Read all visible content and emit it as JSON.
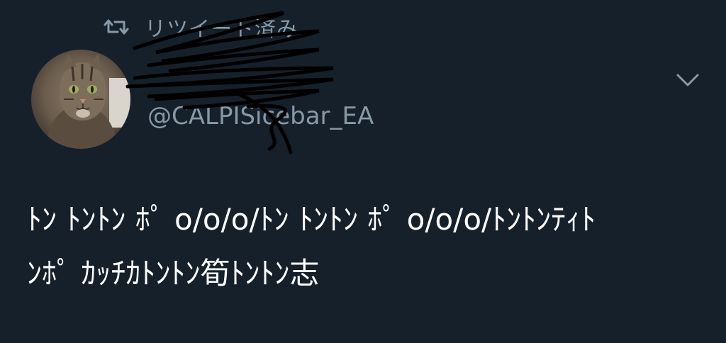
{
  "retweet": {
    "icon": "retweet-icon",
    "label": "リツイート済み"
  },
  "author": {
    "display_name": "",
    "handle": "@CALPISicebar_EA",
    "avatar": "cat-avatar"
  },
  "menu": {
    "icon": "chevron-down-icon"
  },
  "tweet": {
    "line1": "ﾄﾝ ﾄﾝﾄﾝ ﾎﾟ o/o/o/ﾄﾝ ﾄﾝﾄﾝ ﾎﾟ o/o/o/ﾄﾝﾄﾝﾃｨﾄ",
    "line2": "ﾝﾎﾟ ｶｯﾁｶﾄﾝﾄﾝ筍ﾄﾝﾄﾝ志"
  },
  "colors": {
    "background": "#15202b",
    "text": "#ffffff",
    "secondary": "#8899a6"
  }
}
